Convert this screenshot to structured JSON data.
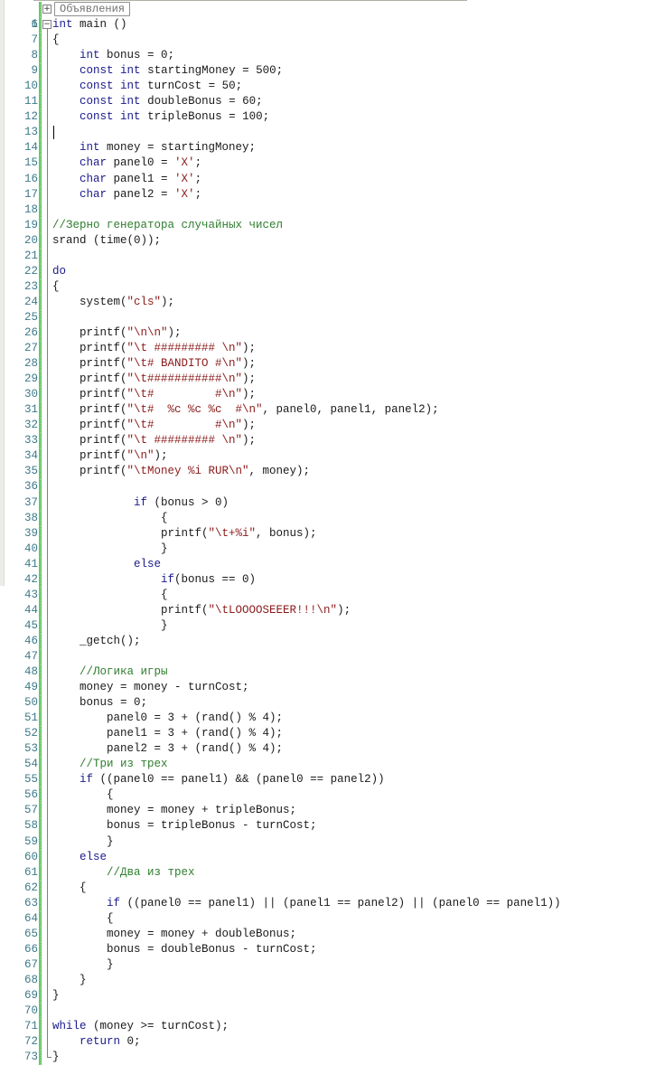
{
  "editor": {
    "collapsed_region": {
      "line_number": "1",
      "label": "Объявления",
      "fold_icon": "plus-box-icon"
    },
    "lines": [
      {
        "n": "6",
        "fold": "minus",
        "code": "int main ()"
      },
      {
        "n": "7",
        "fold": "line",
        "code": "{"
      },
      {
        "n": "8",
        "fold": "line",
        "code": "    int bonus = 0;"
      },
      {
        "n": "9",
        "fold": "line",
        "code": "    const int startingMoney = 500;"
      },
      {
        "n": "10",
        "fold": "line",
        "code": "    const int turnCost = 50;"
      },
      {
        "n": "11",
        "fold": "line",
        "code": "    const int doubleBonus = 60;"
      },
      {
        "n": "12",
        "fold": "line",
        "code": "    const int tripleBonus = 100;"
      },
      {
        "n": "13",
        "fold": "line",
        "code": "",
        "caret": true
      },
      {
        "n": "14",
        "fold": "line",
        "code": "    int money = startingMoney;"
      },
      {
        "n": "15",
        "fold": "line",
        "code": "    char panel0 = 'X';"
      },
      {
        "n": "16",
        "fold": "line",
        "code": "    char panel1 = 'X';"
      },
      {
        "n": "17",
        "fold": "line",
        "code": "    char panel2 = 'X';"
      },
      {
        "n": "18",
        "fold": "line",
        "code": ""
      },
      {
        "n": "19",
        "fold": "line",
        "code": "//Зерно генератора случайных чисел"
      },
      {
        "n": "20",
        "fold": "line",
        "code": "srand (time(0));"
      },
      {
        "n": "21",
        "fold": "line",
        "code": ""
      },
      {
        "n": "22",
        "fold": "line",
        "code": "do"
      },
      {
        "n": "23",
        "fold": "line",
        "code": "{"
      },
      {
        "n": "24",
        "fold": "line",
        "code": "    system(\"cls\");"
      },
      {
        "n": "25",
        "fold": "line",
        "code": ""
      },
      {
        "n": "26",
        "fold": "line",
        "code": "    printf(\"\\n\\n\");"
      },
      {
        "n": "27",
        "fold": "line",
        "code": "    printf(\"\\t ######### \\n\");"
      },
      {
        "n": "28",
        "fold": "line",
        "code": "    printf(\"\\t# BANDITO #\\n\");"
      },
      {
        "n": "29",
        "fold": "line",
        "code": "    printf(\"\\t###########\\n\");"
      },
      {
        "n": "30",
        "fold": "line",
        "code": "    printf(\"\\t#         #\\n\");"
      },
      {
        "n": "31",
        "fold": "line",
        "code": "    printf(\"\\t#  %c %c %c  #\\n\", panel0, panel1, panel2);"
      },
      {
        "n": "32",
        "fold": "line",
        "code": "    printf(\"\\t#         #\\n\");"
      },
      {
        "n": "33",
        "fold": "line",
        "code": "    printf(\"\\t ######### \\n\");"
      },
      {
        "n": "34",
        "fold": "line",
        "code": "    printf(\"\\n\");"
      },
      {
        "n": "35",
        "fold": "line",
        "code": "    printf(\"\\tMoney %i RUR\\n\", money);"
      },
      {
        "n": "36",
        "fold": "line",
        "code": ""
      },
      {
        "n": "37",
        "fold": "line",
        "code": "            if (bonus > 0)"
      },
      {
        "n": "38",
        "fold": "line",
        "code": "                {"
      },
      {
        "n": "39",
        "fold": "line",
        "code": "                printf(\"\\t+%i\", bonus);"
      },
      {
        "n": "40",
        "fold": "line",
        "code": "                }"
      },
      {
        "n": "41",
        "fold": "line",
        "code": "            else"
      },
      {
        "n": "42",
        "fold": "line",
        "code": "                if(bonus == 0)"
      },
      {
        "n": "43",
        "fold": "line",
        "code": "                {"
      },
      {
        "n": "44",
        "fold": "line",
        "code": "                printf(\"\\tLOOOOSEEER!!!\\n\");"
      },
      {
        "n": "45",
        "fold": "line",
        "code": "                }"
      },
      {
        "n": "46",
        "fold": "line",
        "code": "    _getch();"
      },
      {
        "n": "47",
        "fold": "line",
        "code": ""
      },
      {
        "n": "48",
        "fold": "line",
        "code": "    //Логика игры"
      },
      {
        "n": "49",
        "fold": "line",
        "code": "    money = money - turnCost;"
      },
      {
        "n": "50",
        "fold": "line",
        "code": "    bonus = 0;"
      },
      {
        "n": "51",
        "fold": "line",
        "code": "        panel0 = 3 + (rand() % 4);"
      },
      {
        "n": "52",
        "fold": "line",
        "code": "        panel1 = 3 + (rand() % 4);"
      },
      {
        "n": "53",
        "fold": "line",
        "code": "        panel2 = 3 + (rand() % 4);"
      },
      {
        "n": "54",
        "fold": "line",
        "code": "    //Три из трех"
      },
      {
        "n": "55",
        "fold": "line",
        "code": "    if ((panel0 == panel1) && (panel0 == panel2))"
      },
      {
        "n": "56",
        "fold": "line",
        "code": "        {"
      },
      {
        "n": "57",
        "fold": "line",
        "code": "        money = money + tripleBonus;"
      },
      {
        "n": "58",
        "fold": "line",
        "code": "        bonus = tripleBonus - turnCost;"
      },
      {
        "n": "59",
        "fold": "line",
        "code": "        }"
      },
      {
        "n": "60",
        "fold": "line",
        "code": "    else"
      },
      {
        "n": "61",
        "fold": "line",
        "code": "        //Два из трех"
      },
      {
        "n": "62",
        "fold": "line",
        "code": "    {"
      },
      {
        "n": "63",
        "fold": "line",
        "code": "        if ((panel0 == panel1) || (panel1 == panel2) || (panel0 == panel1))"
      },
      {
        "n": "64",
        "fold": "line",
        "code": "        {"
      },
      {
        "n": "65",
        "fold": "line",
        "code": "        money = money + doubleBonus;"
      },
      {
        "n": "66",
        "fold": "line",
        "code": "        bonus = doubleBonus - turnCost;"
      },
      {
        "n": "67",
        "fold": "line",
        "code": "        }"
      },
      {
        "n": "68",
        "fold": "line",
        "code": "    }"
      },
      {
        "n": "69",
        "fold": "line",
        "code": "}"
      },
      {
        "n": "70",
        "fold": "line",
        "code": ""
      },
      {
        "n": "71",
        "fold": "line",
        "code": "while (money >= turnCost);"
      },
      {
        "n": "72",
        "fold": "line",
        "code": "    return 0;"
      },
      {
        "n": "73",
        "fold": "end",
        "code": "}"
      }
    ]
  },
  "colors": {
    "keyword": "#1a1a8c",
    "string": "#8b1a1a",
    "comment": "#2e7d2e",
    "line_number": "#3d7a8a",
    "change_bar": "#5cc45c"
  }
}
